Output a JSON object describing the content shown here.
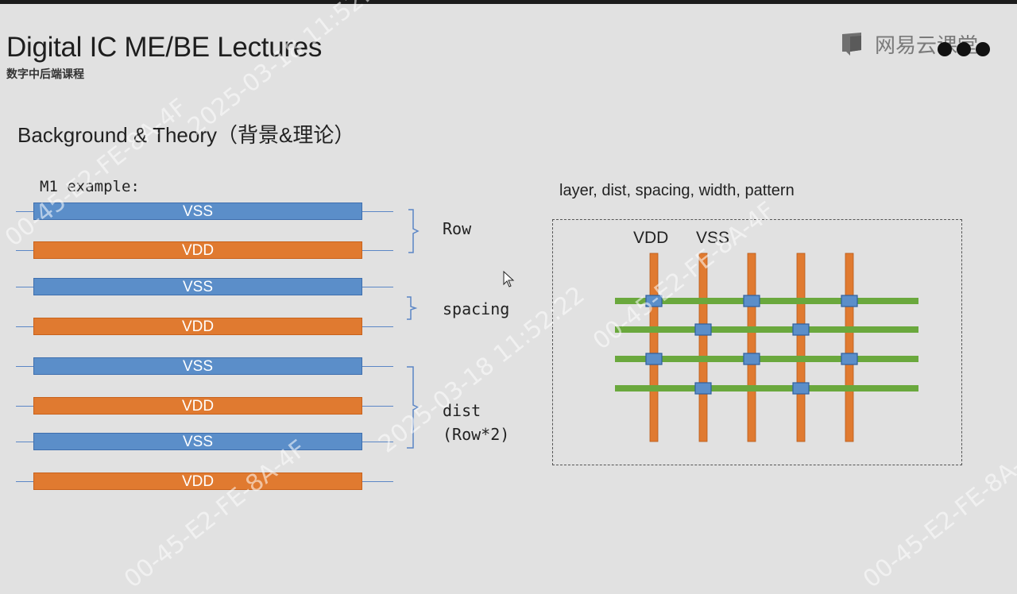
{
  "header": {
    "title": "Digital IC ME/BE Lectures",
    "subtitle": "数字中后端课程",
    "logo_text": "网易云课堂",
    "logo_icon": "netease-cloud-classroom-icon"
  },
  "section_title": "Background & Theory（背景&理论）",
  "m1_example": {
    "label": "M1 example:",
    "rails": [
      {
        "name": "VSS",
        "color": "#5b8ec9"
      },
      {
        "name": "VDD",
        "color": "#e07a30"
      },
      {
        "name": "VSS",
        "color": "#5b8ec9"
      },
      {
        "name": "VDD",
        "color": "#e07a30"
      },
      {
        "name": "VSS",
        "color": "#5b8ec9"
      },
      {
        "name": "VDD",
        "color": "#e07a30"
      },
      {
        "name": "VSS",
        "color": "#5b8ec9"
      },
      {
        "name": "VDD",
        "color": "#e07a30"
      }
    ],
    "annotations": {
      "row": "Row",
      "spacing": "spacing",
      "dist": "dist",
      "dist_note": "(Row*2)"
    }
  },
  "grid": {
    "caption": "layer, dist, spacing, width, pattern",
    "vdd_label": "VDD",
    "vss_label": "VSS",
    "colors": {
      "vertical": "#e07a30",
      "horizontal": "#6aa83d",
      "via": "#5b8ec9"
    }
  },
  "watermark": {
    "date_text": "2025-03-18  11:52:22",
    "id_text": "00-45-E2-FE-8A-4F"
  }
}
